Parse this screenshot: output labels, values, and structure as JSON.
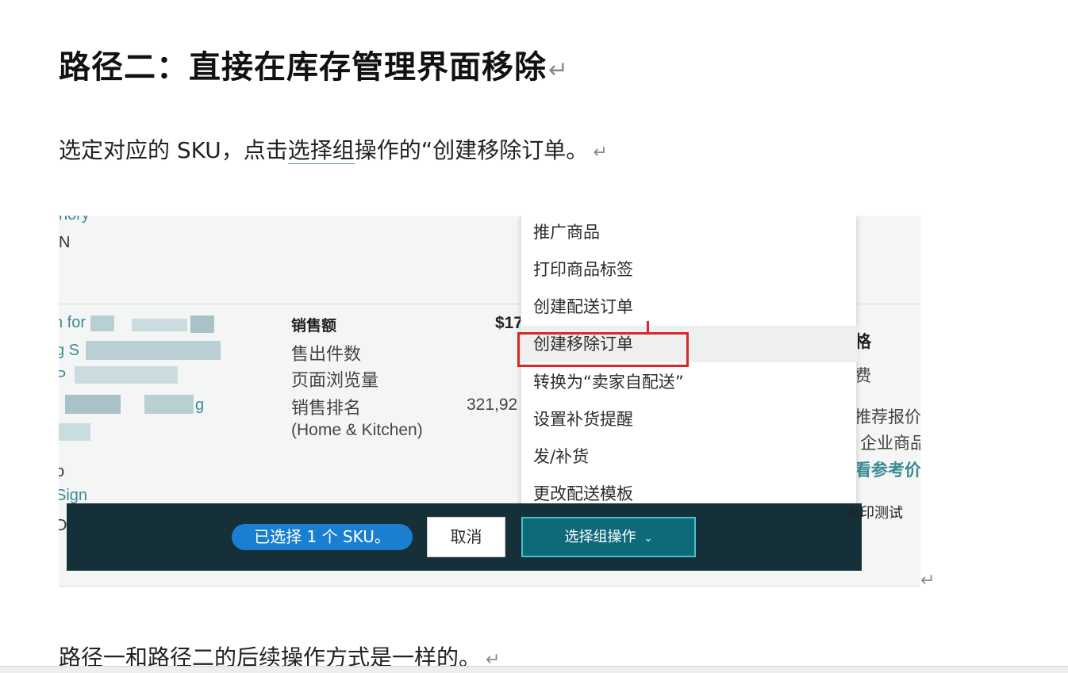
{
  "heading": "路径二：直接在库存管理界面移除",
  "para1": {
    "before": "选定对应的 SKU，点击",
    "underlined": "选择组",
    "after": "操作的“创建移除订单。"
  },
  "para2": "路径一和路径二的后续操作方式是一样的。",
  "paragraph_mark": "↵",
  "screenshot": {
    "left_fragments": {
      "top_line": "nory",
      "asin_line": "N",
      "product_line1": "n for",
      "product_line2": "g S",
      "product_line3": "P",
      "product_line4": "g",
      "product_line5": "o",
      "sign_line": "Sign",
      "d_line": "D"
    },
    "stats": {
      "sales_label": "销售额",
      "sales_value": "$17",
      "units_label": "售出件数",
      "views_label": "页面浏览量",
      "rank_label": "销售排名",
      "rank_value": "321,92",
      "rank_category": "(Home & Kitchen)"
    },
    "right_fragments": {
      "r1": "格",
      "r2": "费",
      "r3": "推荐报价",
      "r4": "企业商品",
      "r5": "看参考价"
    },
    "menu_items": [
      "推广商品",
      "打印商品标签",
      "创建配送订单",
      "创建移除订单",
      "转换为“卖家自配送”",
      "设置补货提醒",
      "发/补货",
      "更改配送模板"
    ],
    "highlighted_item": "创建移除订单",
    "action_bar": {
      "selected_count": "已选择 1 个 SKU。",
      "cancel_label": "取消",
      "group_action_label": "选择组操作"
    },
    "watermark": "水印测试"
  },
  "colors": {
    "highlight_box": "#d42a2a",
    "action_bar_bg": "#16303a",
    "pill_bg": "#1a7fd1",
    "group_button_bg": "#0e6a79",
    "link_teal": "#3c8a94"
  }
}
